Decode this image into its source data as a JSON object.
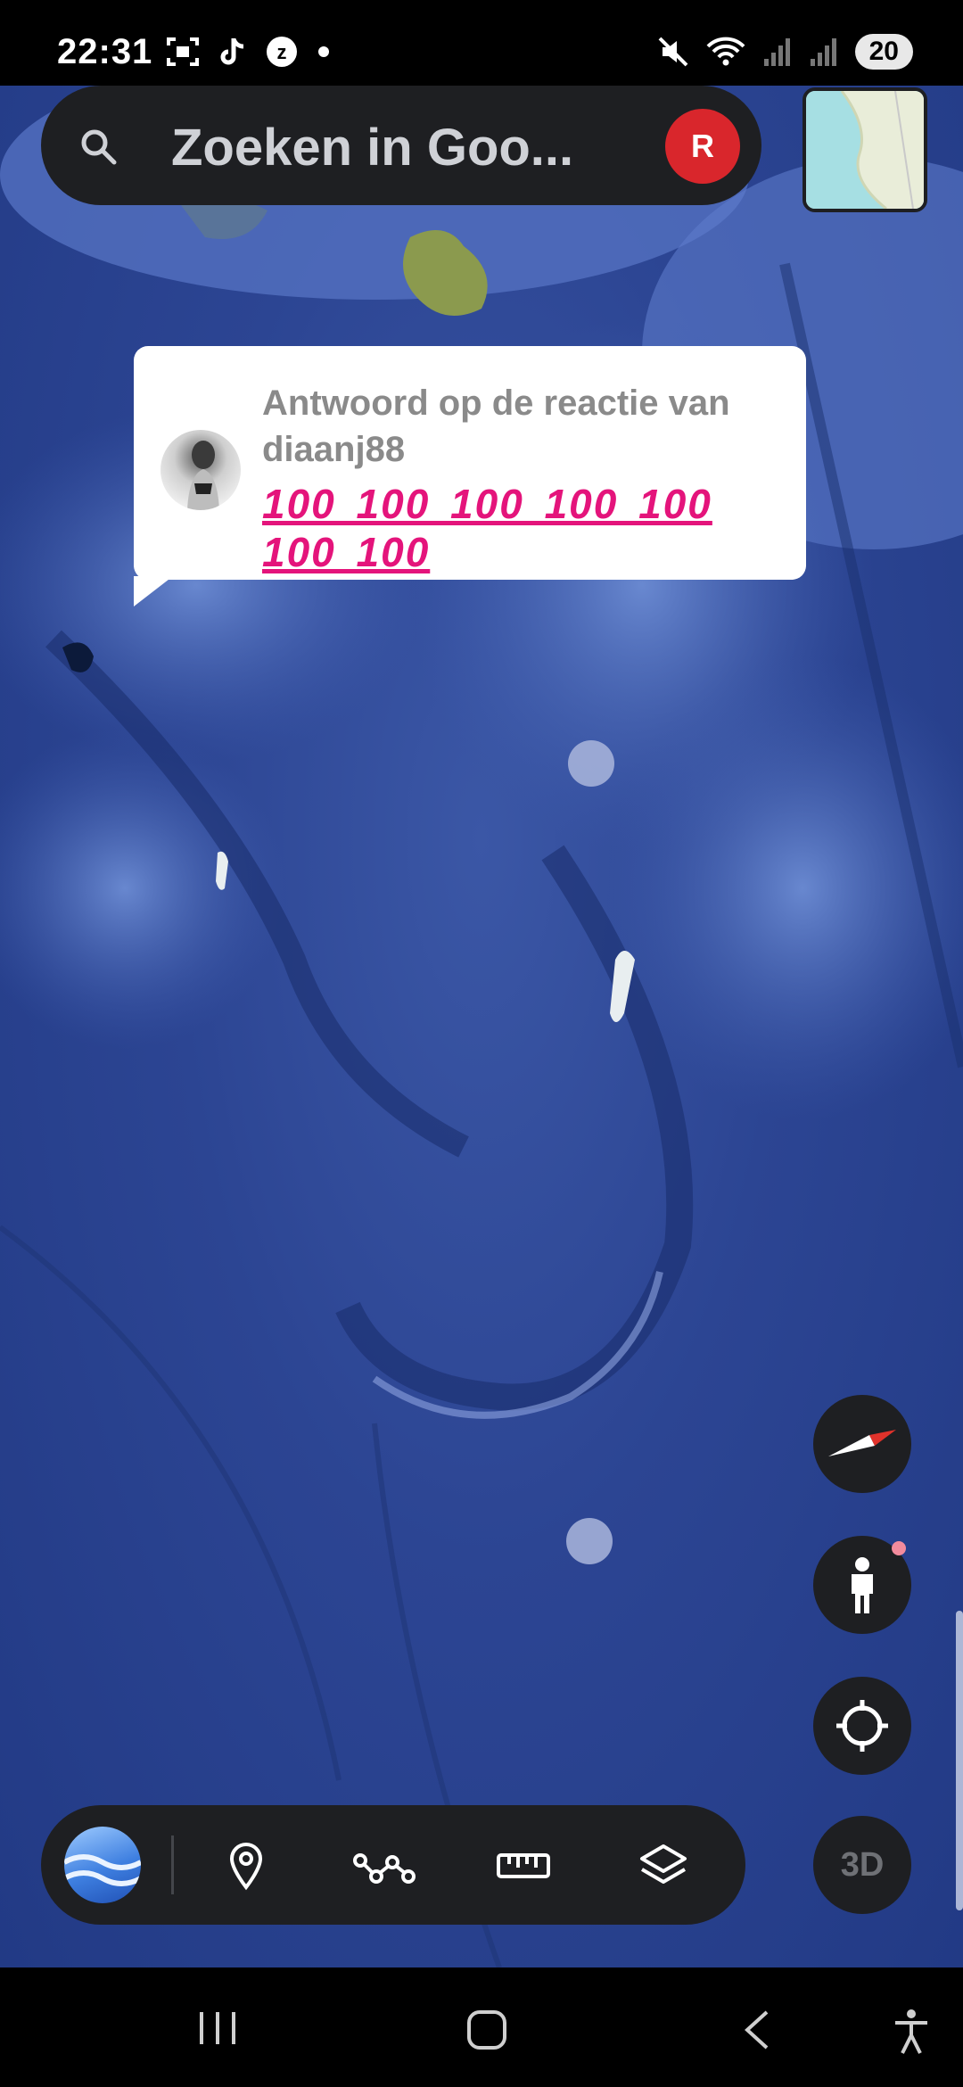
{
  "status_bar": {
    "time": "22:31",
    "battery": "20",
    "icons": [
      "screen-capture-icon",
      "tiktok-icon",
      "z-badge-icon",
      "dot-icon",
      "mute-icon",
      "wifi-icon",
      "signal-icon",
      "signal-icon-2"
    ]
  },
  "search": {
    "placeholder": "Zoeken in Goo...",
    "avatar_letter": "R",
    "avatar_color": "#d9262c"
  },
  "comment": {
    "title": "Antwoord op de reactie van diaanj88",
    "emojis": "💯💯💯💯💯💯💯",
    "emoji_fallback": "100 100 100 100 100 100 100"
  },
  "controls": {
    "compass": "compass-icon",
    "pegman": "pegman-icon",
    "locate": "my-location-icon",
    "view_3d_label": "3D"
  },
  "toolbar": {
    "items": [
      "earth-icon",
      "place-pin-icon",
      "path-icon",
      "measure-ruler-icon",
      "layers-icon"
    ]
  },
  "navigation": {
    "items": [
      "recent-apps-icon",
      "home-icon",
      "back-icon",
      "accessibility-icon"
    ]
  },
  "colors": {
    "ocean": "#2c4593",
    "panel": "#1e1f22",
    "accent_emoji": "#e4147b"
  }
}
